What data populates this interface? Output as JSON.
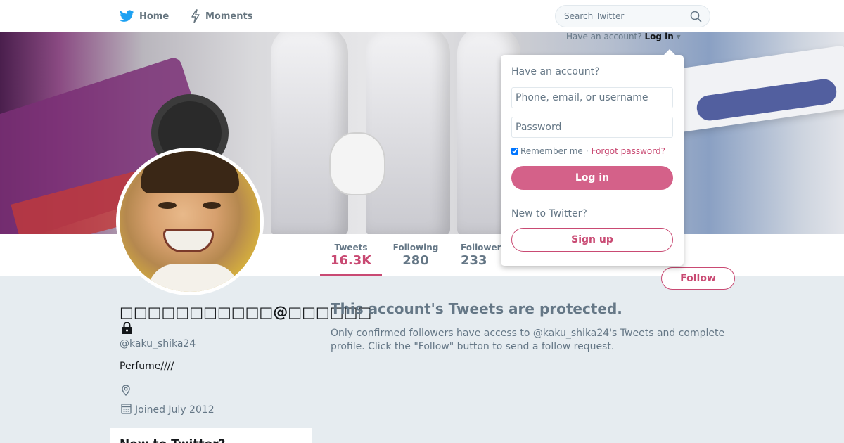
{
  "topnav": {
    "home_label": "Home",
    "moments_label": "Moments",
    "search_placeholder": "Search Twitter",
    "brand_color": "#1da1f2",
    "icons": [
      "twitter-bird-icon",
      "lightning-icon",
      "search-icon"
    ]
  },
  "login_menu": {
    "prompt": "Have an account?",
    "login_label": "Log in"
  },
  "dropdown": {
    "heading": "Have an account?",
    "username_placeholder": "Phone, email, or username",
    "password_placeholder": "Password",
    "remember_label": "Remember me",
    "separator": "·",
    "forgot_label": "Forgot password?",
    "login_button": "Log in",
    "new_prompt": "New to Twitter?",
    "signup_button": "Sign up"
  },
  "stats": {
    "tweets_label": "Tweets",
    "tweets_value": "16.3K",
    "following_label": "Following",
    "following_value": "280",
    "followers_label": "Followers",
    "followers_value": "233"
  },
  "profile": {
    "display_name": "□□□□□□□□□□□@□□□□□□",
    "handle": "@kaku_shika24",
    "bio": "Perfume////",
    "joined": "Joined July 2012",
    "follow_button": "Follow",
    "accent_color": "#c94a73"
  },
  "protected": {
    "title": "This account's Tweets are protected.",
    "text": "Only confirmed followers have access to @kaku_shika24's Tweets and complete profile. Click the \"Follow\" button to send a follow request."
  },
  "sidebar_card": {
    "title": "New to Twitter?"
  }
}
